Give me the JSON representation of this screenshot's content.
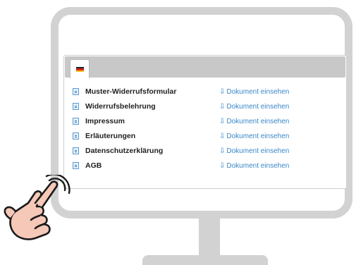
{
  "colors": {
    "monitor": "#d2d2d2",
    "tab_bar": "#c8c8c8",
    "link": "#3a87c8",
    "doc_icon": "#5d9bd3",
    "hand_skin": "#f6c8b8",
    "flag": [
      "#222222",
      "#d9271d",
      "#f2c418"
    ]
  },
  "tabs": [
    {
      "icon": "german-flag-icon",
      "active": true
    }
  ],
  "documents": {
    "link_icon": "download-icon",
    "items": [
      {
        "icon": "document-icon",
        "name": "Muster-Widerrufsformular",
        "link": "Dokument einsehen"
      },
      {
        "icon": "document-icon",
        "name": "Widerrufsbelehrung",
        "link": "Dokument einsehen"
      },
      {
        "icon": "document-icon",
        "name": "Impressum",
        "link": "Dokument einsehen"
      },
      {
        "icon": "document-icon",
        "name": "Erläuterungen",
        "link": "Dokument einsehen"
      },
      {
        "icon": "document-icon",
        "name": "Datenschutzerklärung",
        "link": "Dokument einsehen"
      },
      {
        "icon": "document-icon",
        "name": "AGB",
        "link": "Dokument einsehen"
      }
    ]
  },
  "illustration": {
    "monitor": "monitor-illustration",
    "hand": "pointing-hand-icon"
  }
}
